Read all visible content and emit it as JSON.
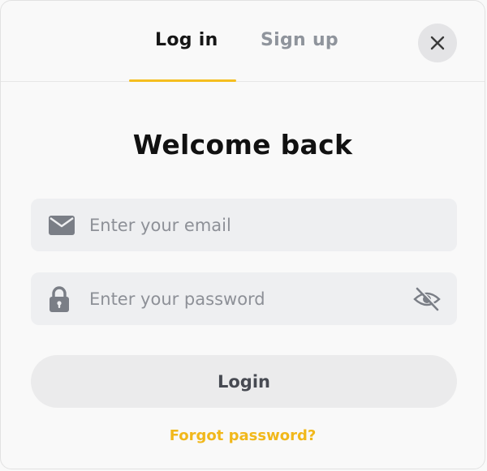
{
  "tabs": {
    "login_label": "Log in",
    "signup_label": "Sign up",
    "active": "login"
  },
  "heading": "Welcome back",
  "email": {
    "placeholder": "Enter your email",
    "value": "",
    "icon": "envelope-icon"
  },
  "password": {
    "placeholder": "Enter your password",
    "value": "",
    "icon": "lock-icon",
    "toggle_icon": "eye-off-icon"
  },
  "login_button_label": "Login",
  "forgot_password_label": "Forgot password?",
  "close_icon": "close-icon",
  "colors": {
    "accent": "#f5be1f",
    "field_bg": "#eeeff1",
    "icon_gray": "#7a7e86"
  }
}
